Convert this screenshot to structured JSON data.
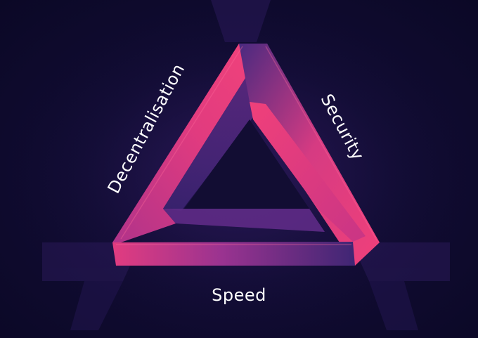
{
  "diagram": {
    "labels": {
      "left": "Decentralisation",
      "right": "Security",
      "bottom": "Speed"
    },
    "colors": {
      "background": "#0d0a2a",
      "pink": "#f0407a",
      "magenta": "#c23588",
      "purple": "#5a2c86",
      "deep_purple": "#3b2470"
    }
  }
}
